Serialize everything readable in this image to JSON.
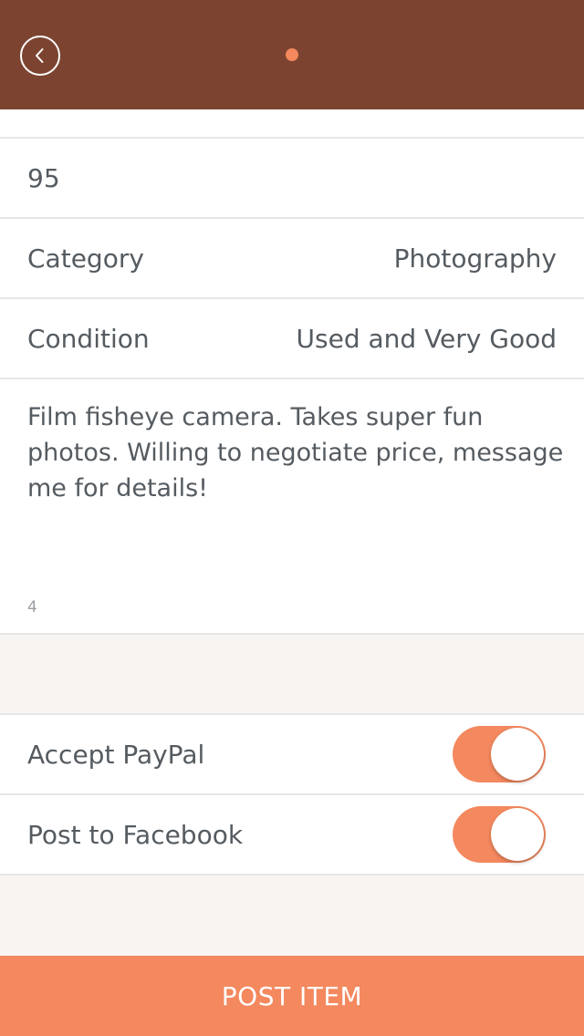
{
  "header": {
    "back_icon": "chevron-left-icon",
    "page_indicator_color": "#f4885e",
    "bar_color": "#7c4430"
  },
  "form": {
    "price_value": "95",
    "category": {
      "label": "Category",
      "value": "Photography"
    },
    "condition": {
      "label": "Condition",
      "value": "Used and Very Good"
    },
    "description": "Film fisheye camera. Takes super fun photos. Willing to negotiate price, message me for details!",
    "description_counter": "4"
  },
  "options": {
    "paypal": {
      "label": "Accept PayPal",
      "enabled": true
    },
    "facebook": {
      "label": "Post to Facebook",
      "enabled": true
    }
  },
  "footer": {
    "post_label": "POST ITEM",
    "accent_color": "#f4885e"
  }
}
